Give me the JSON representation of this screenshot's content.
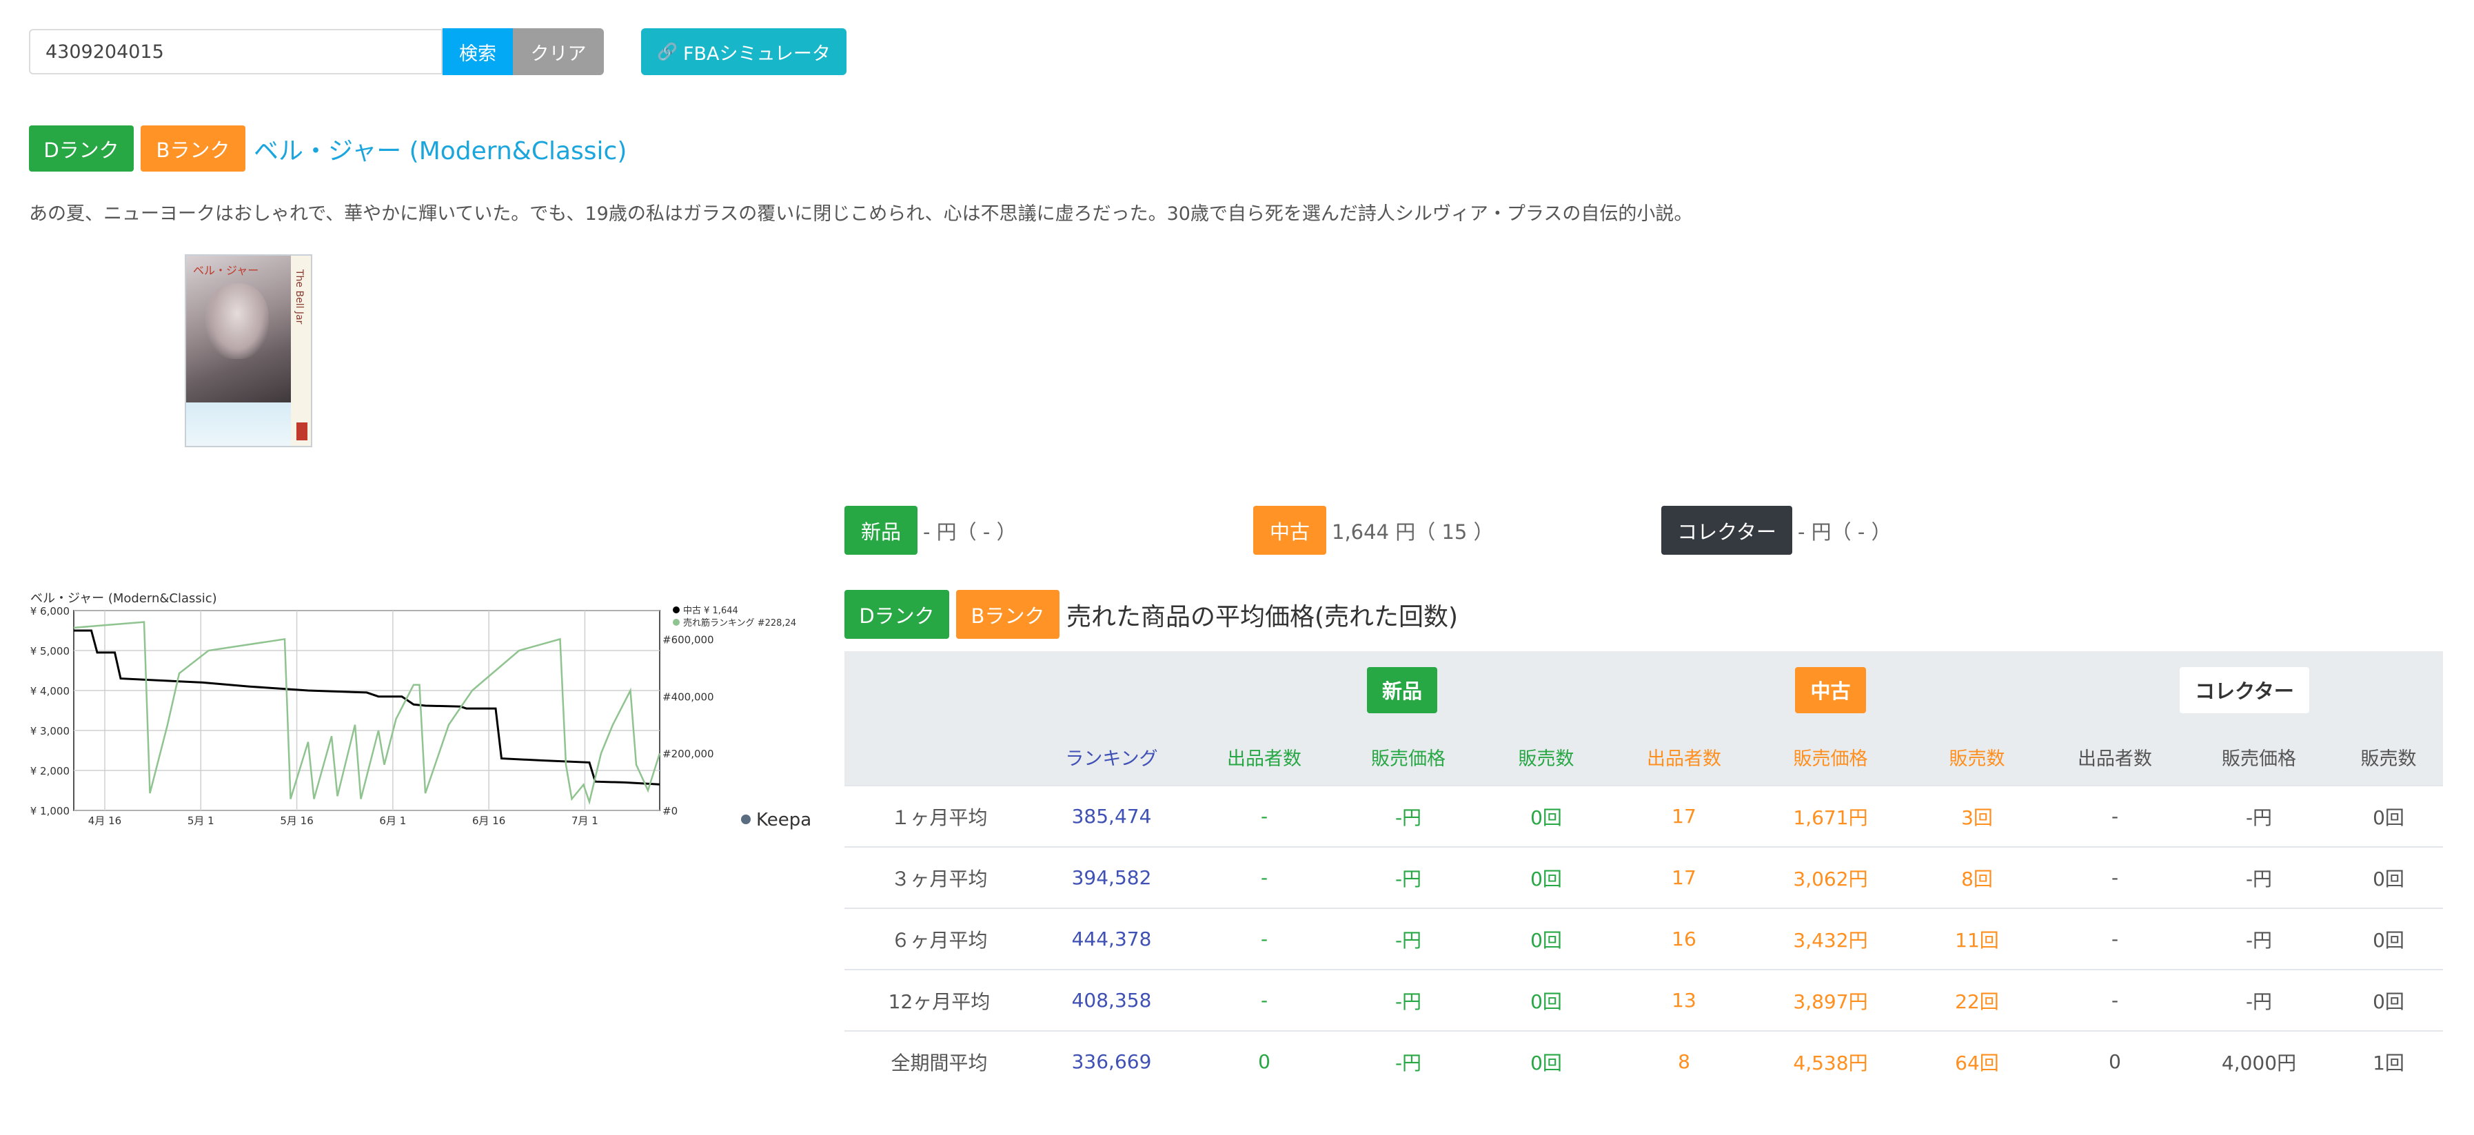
{
  "search": {
    "value": "4309204015",
    "search_label": "検索",
    "clear_label": "クリア"
  },
  "fba_button": {
    "label": "FBAシミュレータ"
  },
  "product": {
    "rank_badges": [
      "Dランク",
      "Bランク"
    ],
    "title": "ベル・ジャー (Modern&Classic)",
    "description": "あの夏、ニューヨークはおしゃれで、華やかに輝いていた。でも、19歳の私はガラスの覆いに閉じこめられ、心は不思議に虚ろだった。30歳で自ら死を選んだ詩人シルヴィア・プラスの自伝的小説。",
    "cover": {
      "jp_title": "ベル・ジャー",
      "en_title": "The Bell Jar"
    }
  },
  "prices": {
    "new": {
      "label": "新品",
      "text": "- 円（ - ）"
    },
    "used": {
      "label": "中古",
      "text": "1,644 円（ 15 ）"
    },
    "collector": {
      "label": "コレクター",
      "text": "- 円（ - ）"
    }
  },
  "average_section": {
    "badges": [
      "Dランク",
      "Bランク"
    ],
    "title": "売れた商品の平均価格(売れた回数)"
  },
  "table": {
    "groups": [
      "新品",
      "中古",
      "コレクター"
    ],
    "columns": [
      "ランキング",
      "出品者数",
      "販売価格",
      "販売数",
      "出品者数",
      "販売価格",
      "販売数",
      "出品者数",
      "販売価格",
      "販売数"
    ],
    "rows": [
      {
        "label": "１ヶ月平均",
        "cells": [
          "385,474",
          "-",
          "-円",
          "0回",
          "17",
          "1,671円",
          "3回",
          "-",
          "-円",
          "0回"
        ]
      },
      {
        "label": "３ヶ月平均",
        "cells": [
          "394,582",
          "-",
          "-円",
          "0回",
          "17",
          "3,062円",
          "8回",
          "-",
          "-円",
          "0回"
        ]
      },
      {
        "label": "６ヶ月平均",
        "cells": [
          "444,378",
          "-",
          "-円",
          "0回",
          "16",
          "3,432円",
          "11回",
          "-",
          "-円",
          "0回"
        ]
      },
      {
        "label": "12ヶ月平均",
        "cells": [
          "408,358",
          "-",
          "-円",
          "0回",
          "13",
          "3,897円",
          "22回",
          "-",
          "-円",
          "0回"
        ]
      },
      {
        "label": "全期間平均",
        "cells": [
          "336,669",
          "0",
          "-円",
          "0回",
          "8",
          "4,538円",
          "64回",
          "0",
          "4,000円",
          "1回"
        ]
      }
    ]
  },
  "colors": {
    "green": "#28a745",
    "orange": "#ff9326",
    "dark": "#343a40",
    "blue": "#03a9f4",
    "teal": "#17b6c9",
    "rank_text": "#3f51b5"
  },
  "chart_data": {
    "type": "line",
    "title": "ベル・ジャー (Modern&Classic)",
    "x_labels": [
      "4月 16",
      "5月 1",
      "5月 16",
      "6月 1",
      "6月 16",
      "7月 1"
    ],
    "left_axis": {
      "ticks": [
        "¥ 1,000",
        "¥ 2,000",
        "¥ 3,000",
        "¥ 4,000",
        "¥ 5,000",
        "¥ 6,000"
      ],
      "ylim": [
        1000,
        6000
      ]
    },
    "right_axis": {
      "ticks": [
        "#0",
        "#200,000",
        "#400,000",
        "#600,000"
      ],
      "ylim": [
        0,
        700000
      ]
    },
    "legend": [
      {
        "name": "中古 ¥ 1,644",
        "color": "#000000"
      },
      {
        "name": "売れ筋ランキング #228,24",
        "color": "#8fc38f"
      }
    ],
    "brand": "Keepa",
    "series": [
      {
        "name": "中古",
        "axis": "left",
        "color": "#000000",
        "points": [
          [
            0,
            5500
          ],
          [
            0.03,
            5500
          ],
          [
            0.04,
            4950
          ],
          [
            0.07,
            4950
          ],
          [
            0.08,
            4300
          ],
          [
            0.15,
            4250
          ],
          [
            0.22,
            4200
          ],
          [
            0.3,
            4100
          ],
          [
            0.4,
            4000
          ],
          [
            0.5,
            3950
          ],
          [
            0.52,
            3850
          ],
          [
            0.56,
            3850
          ],
          [
            0.58,
            3650
          ],
          [
            0.6,
            3620
          ],
          [
            0.66,
            3600
          ],
          [
            0.67,
            3550
          ],
          [
            0.72,
            3550
          ],
          [
            0.73,
            2300
          ],
          [
            0.8,
            2250
          ],
          [
            0.88,
            2200
          ],
          [
            0.89,
            1720
          ],
          [
            0.94,
            1700
          ],
          [
            1.0,
            1650
          ]
        ]
      },
      {
        "name": "売れ筋ランキング",
        "axis": "right",
        "color": "#8fc38f",
        "points": [
          [
            0,
            640000
          ],
          [
            0.12,
            660000
          ],
          [
            0.13,
            60000
          ],
          [
            0.16,
            300000
          ],
          [
            0.18,
            480000
          ],
          [
            0.23,
            560000
          ],
          [
            0.36,
            600000
          ],
          [
            0.37,
            40000
          ],
          [
            0.4,
            240000
          ],
          [
            0.41,
            40000
          ],
          [
            0.44,
            260000
          ],
          [
            0.45,
            50000
          ],
          [
            0.48,
            300000
          ],
          [
            0.49,
            40000
          ],
          [
            0.52,
            280000
          ],
          [
            0.53,
            160000
          ],
          [
            0.55,
            320000
          ],
          [
            0.58,
            440000
          ],
          [
            0.59,
            440000
          ],
          [
            0.6,
            60000
          ],
          [
            0.64,
            300000
          ],
          [
            0.68,
            420000
          ],
          [
            0.76,
            560000
          ],
          [
            0.83,
            600000
          ],
          [
            0.84,
            160000
          ],
          [
            0.85,
            40000
          ],
          [
            0.87,
            90000
          ],
          [
            0.88,
            30000
          ],
          [
            0.9,
            200000
          ],
          [
            0.92,
            300000
          ],
          [
            0.95,
            420000
          ],
          [
            0.96,
            160000
          ],
          [
            0.98,
            70000
          ],
          [
            1.0,
            200000
          ]
        ]
      }
    ]
  }
}
